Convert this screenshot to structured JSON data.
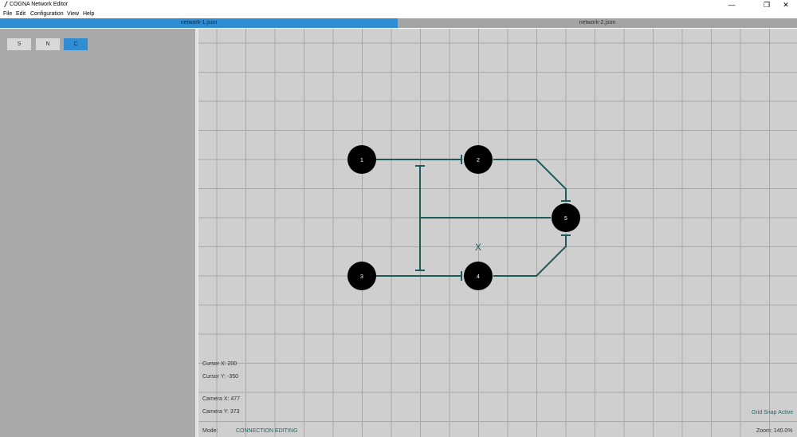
{
  "window": {
    "title": "COGNA Network Editor",
    "controls": {
      "minimize": "—",
      "maximize": "❐",
      "close": "✕"
    }
  },
  "menu": {
    "items": [
      "File",
      "Edit",
      "Configuration",
      "View",
      "Help"
    ]
  },
  "tabs": [
    {
      "label": "network-1.json",
      "active": true
    },
    {
      "label": "network-2.json",
      "active": false
    }
  ],
  "toolbar": {
    "buttons": [
      {
        "label": "S",
        "active": false
      },
      {
        "label": "N",
        "active": false
      },
      {
        "label": "C",
        "active": true
      }
    ]
  },
  "canvas": {
    "nodes": [
      {
        "id": "1",
        "label": "1"
      },
      {
        "id": "2",
        "label": "2"
      },
      {
        "id": "3",
        "label": "3"
      },
      {
        "id": "4",
        "label": "4"
      },
      {
        "id": "5",
        "label": "5"
      }
    ],
    "marker": "X"
  },
  "status": {
    "cursor_x": "Cursor X: 200",
    "cursor_y": "Cursor Y: -350",
    "camera_x": "Camera X: 477",
    "camera_y": "Camera Y: 373",
    "grid_snap": "Grid Snap Active",
    "mode_label": "Mode:",
    "mode_value": "CONNECTION EDITING",
    "zoom": "Zoom: 140.0%"
  },
  "colors": {
    "accent": "#2f8ed3",
    "connection": "#1e5a5a",
    "node_fill": "#000000",
    "canvas_bg": "#cfcfcf",
    "grid_line": "#a8a8a8"
  }
}
